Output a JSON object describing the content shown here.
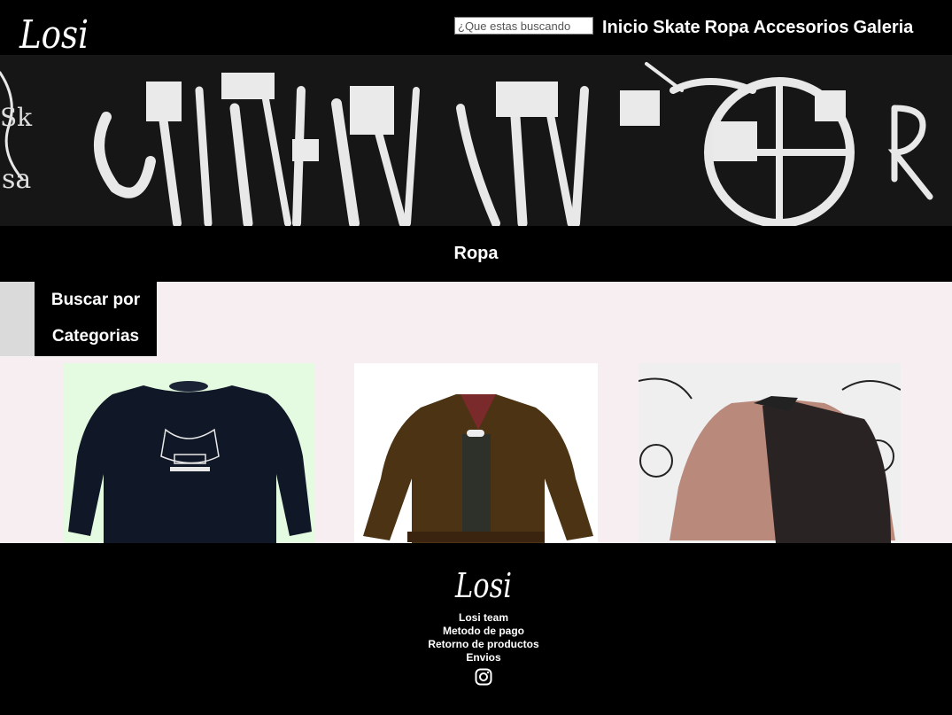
{
  "header": {
    "logo_text": "Losi",
    "search": {
      "placeholder": "¿Que estas buscando",
      "value": ""
    },
    "nav": [
      "Inicio",
      "Skate",
      "Ropa",
      "Accesorios",
      "Galeria"
    ]
  },
  "banner": {
    "icon": "graffiti-banner-image"
  },
  "section": {
    "title": "Ropa"
  },
  "categories": {
    "label_line1": "Buscar por",
    "label_line2": "Categorias"
  },
  "products": [
    {
      "icon": "navy-sweatshirt-image",
      "color": "#0f1626"
    },
    {
      "icon": "brown-corduroy-jacket-image",
      "color": "#4d3616"
    },
    {
      "icon": "plaid-jacket-image",
      "color": "#b98a7c"
    }
  ],
  "footer": {
    "logo_text": "Losi",
    "links": [
      "Losi team",
      "Metodo de pago",
      "Retorno de productos",
      "Envios"
    ],
    "social_icon": "instagram-icon"
  },
  "colors": {
    "bar": "#000000",
    "page_bg": "#f6eef0",
    "side_tab": "#dadada"
  }
}
